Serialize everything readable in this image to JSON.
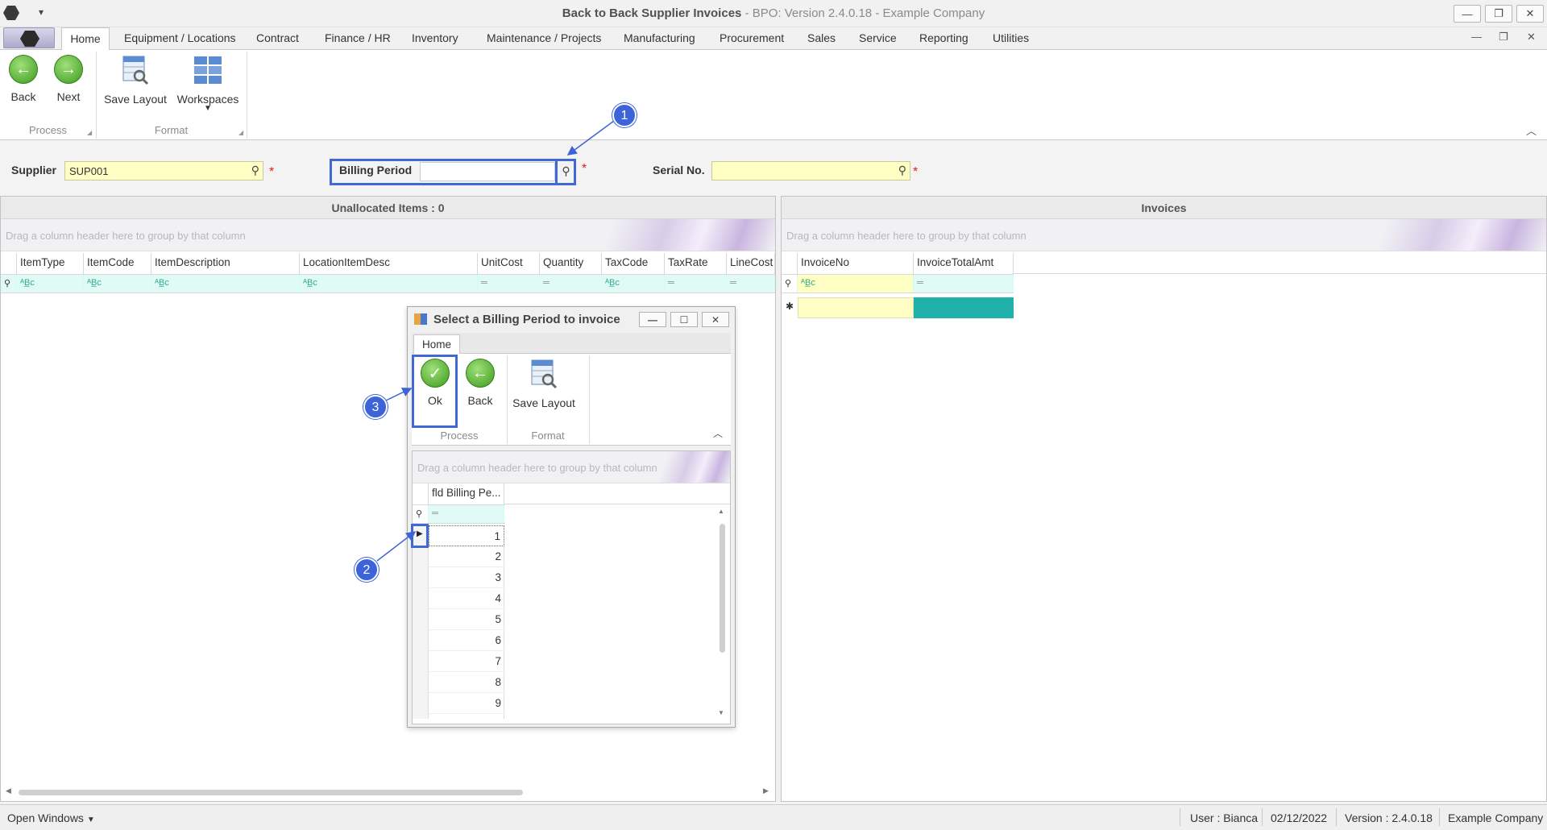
{
  "window": {
    "title_bold": "Back to Back Supplier Invoices",
    "title_rest": " - BPO: Version 2.4.0.18 - Example Company"
  },
  "menu": {
    "home": "Home",
    "tabs": [
      "Equipment / Locations",
      "Contract",
      "Finance / HR",
      "Inventory",
      "Maintenance / Projects",
      "Manufacturing",
      "Procurement",
      "Sales",
      "Service",
      "Reporting",
      "Utilities"
    ]
  },
  "ribbon": {
    "back": "Back",
    "next": "Next",
    "save_layout": "Save Layout",
    "workspaces": "Workspaces",
    "group_process": "Process",
    "group_format": "Format"
  },
  "filters": {
    "supplier_label": "Supplier",
    "supplier_value": "SUP001",
    "billing_label": "Billing Period",
    "billing_value": "",
    "serial_label": "Serial No.",
    "serial_value": ""
  },
  "left_panel": {
    "title": "Unallocated Items : 0",
    "group_hint": "Drag a column header here to group by that column",
    "columns": [
      "ItemType",
      "ItemCode",
      "ItemDescription",
      "LocationItemDesc",
      "UnitCost",
      "Quantity",
      "TaxCode",
      "TaxRate",
      "LineCost"
    ]
  },
  "right_panel": {
    "title": "Invoices",
    "group_hint": "Drag a column header here to group by that column",
    "columns": [
      "InvoiceNo",
      "InvoiceTotalAmt"
    ]
  },
  "dialog": {
    "title": "Select a Billing Period to invoice",
    "tab": "Home",
    "ok": "Ok",
    "back": "Back",
    "save_layout": "Save Layout",
    "group_process": "Process",
    "group_format": "Format",
    "group_hint": "Drag a column header here to group by that column",
    "column": "fld Billing Pe...",
    "rows": [
      "1",
      "2",
      "3",
      "4",
      "5",
      "6",
      "7",
      "8",
      "9"
    ]
  },
  "callouts": [
    "1",
    "2",
    "3"
  ],
  "status": {
    "open_windows": "Open Windows",
    "user": "User : Bianca",
    "date": "02/12/2022",
    "version": "Version : 2.4.0.18",
    "company": "Example Company"
  },
  "colors": {
    "filter_bg": "#ffffc4",
    "filter_row": "#e0fbf6",
    "teal_cell": "#20b2aa",
    "callout": "#3c64d8"
  }
}
